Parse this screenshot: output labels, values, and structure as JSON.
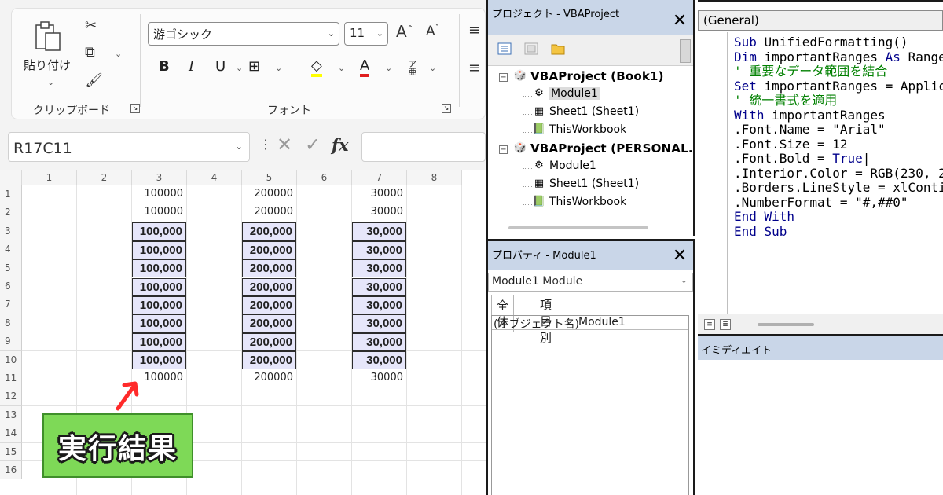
{
  "excel": {
    "ribbon": {
      "paste_label": "貼り付け",
      "clipboard_group_label": "クリップボード",
      "font_name": "游ゴシック",
      "font_size": "11",
      "bold_label": "B",
      "italic_label": "I",
      "underline_label": "U",
      "grow_font_label": "A",
      "shrink_font_label": "A",
      "font_color_label": "A",
      "phonetic_label": "ア亜",
      "font_group_label": "フォント"
    },
    "formula_bar": {
      "name_box": "R17C11",
      "fx_label": "fx"
    },
    "columns": [
      "1",
      "2",
      "3",
      "4",
      "5",
      "6",
      "7",
      "8"
    ],
    "rows": [
      "1",
      "2",
      "3",
      "4",
      "5",
      "6",
      "7",
      "8",
      "9",
      "10",
      "11",
      "12",
      "13",
      "14",
      "15",
      "16"
    ],
    "cells": {
      "row1": [
        "100000",
        "200000",
        "30000"
      ],
      "row2": [
        "100000",
        "200000",
        "30000"
      ],
      "row3": [
        "100,000",
        "200,000",
        "30,000"
      ],
      "row4": [
        "100,000",
        "200,000",
        "30,000"
      ],
      "row5": [
        "100,000",
        "200,000",
        "30,000"
      ],
      "row6": [
        "100,000",
        "200,000",
        "30,000"
      ],
      "row7": [
        "100,000",
        "200,000",
        "30,000"
      ],
      "row8": [
        "100,000",
        "200,000",
        "30,000"
      ],
      "row9": [
        "100,000",
        "200,000",
        "30,000"
      ],
      "row10": [
        "100,000",
        "200,000",
        "30,000"
      ],
      "row11": [
        "100000",
        "200000",
        "30000"
      ]
    },
    "formatted_fill_color": "#e6e6fa",
    "result_badge": "実行結果",
    "badge_color": "#7ed957",
    "arrow_color": "#ff2a2a"
  },
  "vbe": {
    "project_pane": {
      "title": "プロジェクト - VBAProject",
      "close_label": "✕",
      "tree": [
        {
          "label": "VBAProject (Book1)",
          "icon": "vba-project-icon"
        },
        {
          "label": "Module1",
          "icon": "module-icon"
        },
        {
          "label": "Sheet1 (Sheet1)",
          "icon": "sheet-icon"
        },
        {
          "label": "ThisWorkbook",
          "icon": "workbook-icon"
        },
        {
          "label": "VBAProject (PERSONAL.",
          "icon": "vba-project-icon"
        },
        {
          "label": "Module1",
          "icon": "module-icon"
        },
        {
          "label": "Sheet1 (Sheet1)",
          "icon": "sheet-icon"
        },
        {
          "label": "ThisWorkbook",
          "icon": "workbook-icon"
        }
      ]
    },
    "properties_pane": {
      "title": "プロパティ - Module1",
      "close_label": "✕",
      "object_select_name": "Module1",
      "object_select_type": "Module",
      "tabs": [
        "全体",
        "項目別"
      ],
      "rows": [
        {
          "name": "(オブジェクト名)",
          "value": "Module1"
        }
      ]
    },
    "code_pane": {
      "procedure_dropdown": "(General)",
      "lines": [
        {
          "parts": [
            {
              "t": "Sub ",
              "c": "kw"
            },
            {
              "t": "UnifiedFormatting()",
              "c": ""
            }
          ]
        },
        {
          "parts": [
            {
              "t": "Dim ",
              "c": "kw"
            },
            {
              "t": "importantRanges ",
              "c": ""
            },
            {
              "t": "As ",
              "c": "kw"
            },
            {
              "t": "Range",
              "c": ""
            }
          ]
        },
        {
          "parts": [
            {
              "t": "' 重要なデータ範囲を結合",
              "c": "cm"
            }
          ]
        },
        {
          "parts": [
            {
              "t": "Set ",
              "c": "kw"
            },
            {
              "t": "importantRanges = Applic",
              "c": ""
            }
          ]
        },
        {
          "parts": [
            {
              "t": "' 統一書式を適用",
              "c": "cm"
            }
          ]
        },
        {
          "parts": [
            {
              "t": "With ",
              "c": "kw"
            },
            {
              "t": "importantRanges",
              "c": ""
            }
          ]
        },
        {
          "parts": [
            {
              "t": ".Font.Name = \"Arial\"",
              "c": ""
            }
          ]
        },
        {
          "parts": [
            {
              "t": ".Font.Size = 12",
              "c": ""
            }
          ]
        },
        {
          "parts": [
            {
              "t": ".Font.Bold = ",
              "c": ""
            },
            {
              "t": "True",
              "c": "kw"
            },
            {
              "t": "|",
              "c": ""
            }
          ]
        },
        {
          "parts": [
            {
              "t": ".Interior.Color = RGB(230, 2",
              "c": ""
            }
          ]
        },
        {
          "parts": [
            {
              "t": ".Borders.LineStyle = xlConti",
              "c": ""
            }
          ]
        },
        {
          "parts": [
            {
              "t": ".NumberFormat = \"#,##0\"",
              "c": ""
            }
          ]
        },
        {
          "parts": [
            {
              "t": "End With",
              "c": "kw"
            }
          ]
        },
        {
          "parts": [
            {
              "t": "End Sub",
              "c": "kw"
            }
          ]
        }
      ]
    },
    "immediate_pane": {
      "title": "イミディエイト"
    }
  }
}
